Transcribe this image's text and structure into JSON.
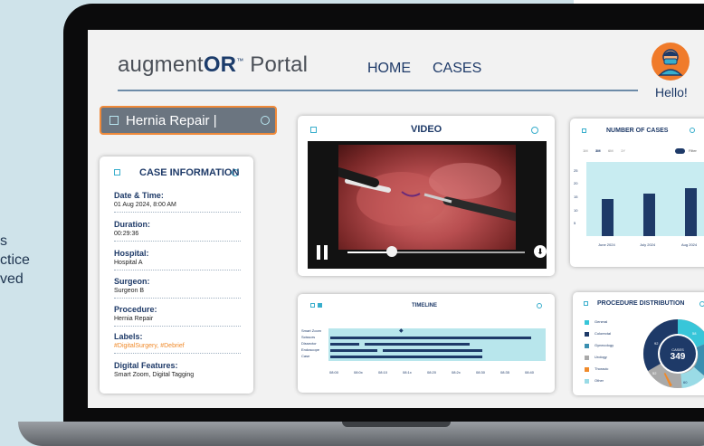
{
  "background_text": {
    "line1": "s",
    "line2": "ctice",
    "line3": "ved"
  },
  "header": {
    "logo_prefix": "augment",
    "logo_bold": "OR",
    "logo_tm": "™",
    "logo_suffix": " Portal",
    "nav_home": "HOME",
    "nav_cases": "CASES",
    "greeting": "Hello!"
  },
  "search": {
    "value": "Hernia Repair |"
  },
  "case_info": {
    "title": "CASE INFORMATION",
    "items": [
      {
        "label": "Date & Time:",
        "value": "01 Aug 2024, 8:00 AM"
      },
      {
        "label": "Duration:",
        "value": "00:29:36"
      },
      {
        "label": "Hospital:",
        "value": "Hospital A"
      },
      {
        "label": "Surgeon:",
        "value": "Surgeon B"
      },
      {
        "label": "Procedure:",
        "value": "Hernia Repair"
      },
      {
        "label": "Labels:",
        "value": "#DigitalSurgery, #Debrief"
      },
      {
        "label": "Digital Features:",
        "value": "Smart Zoom, Digital Tagging"
      }
    ]
  },
  "video": {
    "title": "VIDEO",
    "progress": 0.25
  },
  "timeline": {
    "title": "TIMELINE",
    "rows": [
      "Smart Zoom",
      "Scissors",
      "Dissector",
      "Endoscope",
      "Case"
    ],
    "ticks": [
      "08:00",
      "08:0x",
      "08:10",
      "08:1x",
      "08:20",
      "08:2x",
      "08:30",
      "08:35",
      "08:40"
    ]
  },
  "number_of_cases": {
    "title": "NUMBER OF CASES",
    "ranges": [
      "1M",
      "3M",
      "6M",
      "1Y"
    ],
    "active_range": "3M",
    "filter_label": "Filter"
  },
  "chart_data": {
    "type": "bar",
    "title": "NUMBER OF CASES",
    "categories": [
      "June 2024",
      "July 2024",
      "Aug 2024"
    ],
    "values": [
      14,
      16,
      18
    ],
    "yticks": [
      "25",
      "20",
      "15",
      "10",
      "5"
    ],
    "ylim": [
      0,
      28
    ],
    "colors": {
      "bar": "#1e3a68",
      "background": "#c8ecf1"
    }
  },
  "procedure_distribution": {
    "title": "PROCEDURE DISTRIBUTION",
    "categories": [
      {
        "name": "General",
        "color": "#38c6d9"
      },
      {
        "name": "Colorectal",
        "color": "#1e3a68"
      },
      {
        "name": "Gynecology",
        "color": "#3a8fb0"
      },
      {
        "name": "Urology",
        "color": "#a9a9a9"
      },
      {
        "name": "Thoracic",
        "color": "#f08a2a"
      },
      {
        "name": "Other",
        "color": "#9adbe6"
      }
    ],
    "center_label": "CASES",
    "center_value": "349",
    "slice_labels": [
      "58",
      "72",
      "60",
      "52",
      "92"
    ]
  }
}
